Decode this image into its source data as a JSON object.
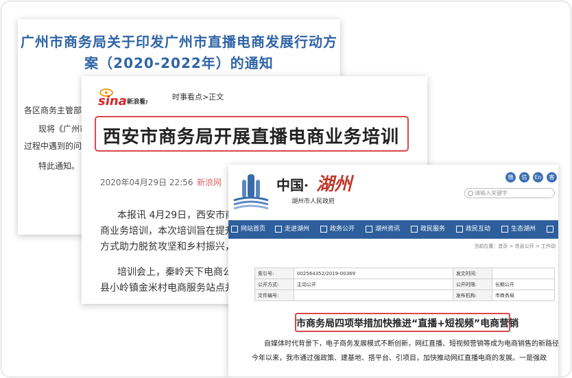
{
  "card1": {
    "title_line1": "广州市商务局关于印发广州市直播电商发展行动方",
    "title_line2": "案（2020-2022年）的通知",
    "line1": "各区商务主管部门",
    "line2": "现将《广州市",
    "line3": "过程中遇到的问题",
    "line4": "特此通知。"
  },
  "card2": {
    "logo_text": "sina",
    "logo_sub": "新浪看点",
    "breadcrumb": "时事看点>正文",
    "headline": "西安市商务局开展直播电商业务培训",
    "date": "2020年04月29日 22:56",
    "source": "新浪网",
    "body": [
      "本报讯 4月29日，西安市商",
      "商业务培训，本次培训旨在提升",
      "方式助力脱贫攻坚和乡村振兴，",
      "培训会上，秦岭天下电商公",
      "县小岭镇金米村电商服务站点并"
    ]
  },
  "card3": {
    "logo_china": "中国·",
    "logo_huzhou": "湖州",
    "gov_name": "湖州市人民政府",
    "social": [
      "微",
      "信",
      "En",
      "客"
    ],
    "search_placeholder": "请输入关键字",
    "nav": [
      "网站首页",
      "走进湖州",
      "政务公开",
      "湖州资讯",
      "政民服务",
      "政民互动",
      "生态湖州"
    ],
    "crumb": "当前位置：首页 > 信息公开 > 工作动",
    "info_rows": [
      [
        "索引号:",
        "002564352/2019-00369",
        "发文时间:",
        ""
      ],
      [
        "公开方式:",
        "主动公开",
        "公开时限:",
        "长期公开"
      ],
      [
        "文件编号:",
        "",
        "发布机构:",
        "市商务局"
      ]
    ],
    "headline": "市商务局四项举措加快推进“直播+短视频”电商营销",
    "body1": "自媒体时代背景下，电子商务发展模式不断创新，网红直播、短视频营销等成为电商销售的新路径。",
    "body2": "今年以来，我市通过强政策、建基地、搭平台、引项目，加快推动网红直播电商的发展。一是强政"
  }
}
